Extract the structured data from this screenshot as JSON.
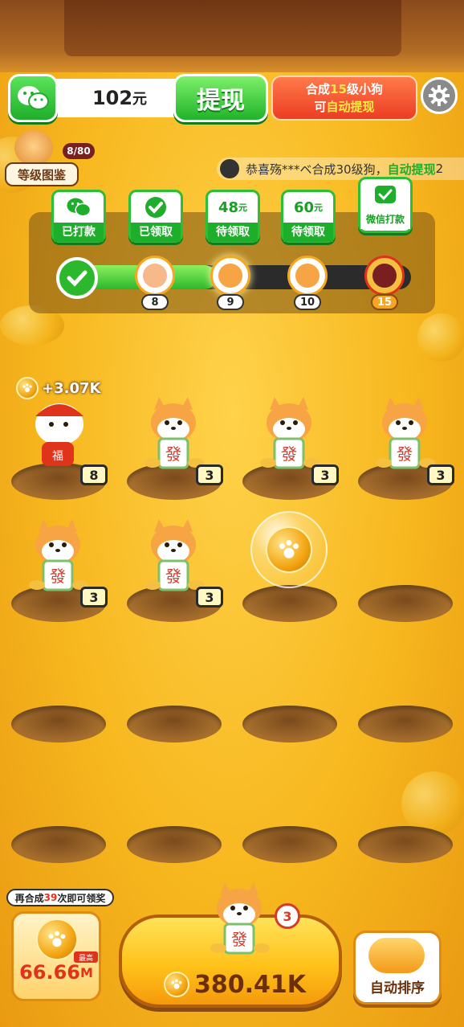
{
  "header": {
    "balance_value": "102",
    "balance_unit": "元",
    "withdraw_label": "提现",
    "promo_line1_pre": "合成",
    "promo_line1_num": "15",
    "promo_line1_post": "级小狗",
    "promo_line2_pre": "可",
    "promo_line2_hl": "自动提现"
  },
  "level_book": {
    "label": "等级图鉴",
    "progress": "8/80"
  },
  "marquee": {
    "text": "恭喜殇***ベ合成30级狗，",
    "highlight": "自动提现",
    "tail": "2"
  },
  "rewards": [
    {
      "top": "",
      "bottom": "已打款",
      "icon": "wechat-icon"
    },
    {
      "top": "",
      "bottom": "已领取",
      "icon": "check-icon"
    },
    {
      "top": "48",
      "unit": "元",
      "bottom": "待领取"
    },
    {
      "top": "60",
      "unit": "元",
      "bottom": "待领取"
    },
    {
      "top": "",
      "bottom": "微信打款",
      "icon": "wechat-icon"
    }
  ],
  "milestones": [
    "8",
    "9",
    "10",
    "15"
  ],
  "progress_fraction": 0.45,
  "grid": {
    "earn_popup": "+3.07K",
    "cells": [
      {
        "level": "8",
        "kind": "dog"
      },
      {
        "level": "3",
        "kind": "dog"
      },
      {
        "level": "3",
        "kind": "dog"
      },
      {
        "level": "3",
        "kind": "dog"
      },
      {
        "level": "3",
        "kind": "dog"
      },
      {
        "level": "3",
        "kind": "dog"
      },
      {
        "level": "",
        "kind": "coin-bubble"
      },
      {
        "level": "",
        "kind": "empty"
      },
      {
        "level": "",
        "kind": "empty"
      },
      {
        "level": "",
        "kind": "empty"
      },
      {
        "level": "",
        "kind": "empty"
      },
      {
        "level": "",
        "kind": "empty"
      },
      {
        "level": "",
        "kind": "empty"
      },
      {
        "level": "",
        "kind": "empty"
      },
      {
        "level": "",
        "kind": "empty"
      },
      {
        "level": "",
        "kind": "empty"
      }
    ]
  },
  "bottom": {
    "tip_pre": "再合成",
    "tip_num": "39",
    "tip_post": "次即可领奖",
    "reward_value": "66.66",
    "reward_unit": "M",
    "max_tag": "最高",
    "buy_price": "380.41K",
    "buy_level": "3",
    "sort_label": "自动排序"
  },
  "colors": {
    "accent_green": "#1fae2b",
    "accent_red": "#ec3d23",
    "gold": "#f5a623"
  }
}
